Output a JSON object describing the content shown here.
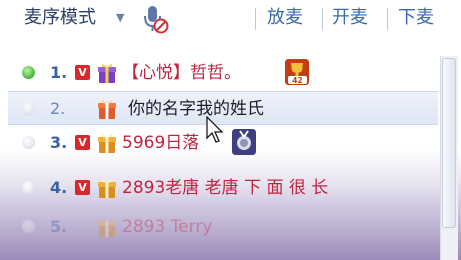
{
  "toolbar": {
    "mode_label": "麦序模式",
    "buttons": [
      {
        "label": "放麦"
      },
      {
        "label": "开麦"
      },
      {
        "label": "下麦"
      }
    ]
  },
  "mic_queue": [
    {
      "number": "1.",
      "name": "【心悦】哲哲。",
      "status": "active",
      "vip": "V",
      "trophy_count": "42"
    },
    {
      "number": "2.",
      "name": "你的名字我的姓氏",
      "status": "selected"
    },
    {
      "number": "3.",
      "name": "5969日落",
      "status": "idle",
      "vip": "V"
    },
    {
      "number": "4.",
      "name": "2893老唐 老唐 下 面 很 长",
      "status": "idle",
      "vip": "V"
    },
    {
      "number": "5.",
      "name": "2893 Terry",
      "status": "idle"
    }
  ],
  "colors": {
    "name_red": "#c0253f",
    "name_dark": "#1e1e28",
    "number_blue": "#3a63a6",
    "button_blue": "#3c6aa7",
    "vip_red": "#d8282b"
  },
  "icons": [
    "chevron-down-icon",
    "mic-muted-icon",
    "vip-icon",
    "gift-icon",
    "trophy-icon",
    "cursor-icon"
  ]
}
